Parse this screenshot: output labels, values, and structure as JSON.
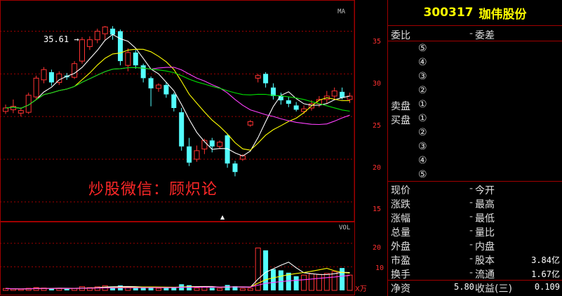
{
  "stock": {
    "code": "300317",
    "name": "珈伟股份"
  },
  "chart": {
    "ma_tag": "MA",
    "vol_tag": "VOL",
    "vol_unit": "X万",
    "high_label": "35.61",
    "watermark": "炒股微信：顾炽论",
    "price_ticks": [
      "35",
      "30",
      "25",
      "20",
      "15"
    ],
    "vol_ticks": [
      "20",
      "10"
    ]
  },
  "panel": {
    "weibi_label": "委比",
    "weicha_label": "委差",
    "sell_label": "卖盘",
    "buy_label": "买盘",
    "sell_levels": [
      "⑤",
      "④",
      "③",
      "②",
      "①"
    ],
    "buy_levels": [
      "①",
      "②",
      "③",
      "④",
      "⑤"
    ],
    "quote_rows": [
      {
        "l": "现价",
        "r": "今开",
        "v": ""
      },
      {
        "l": "涨跌",
        "r": "最高",
        "v": ""
      },
      {
        "l": "涨幅",
        "r": "最低",
        "v": ""
      },
      {
        "l": "总量",
        "r": "量比",
        "v": ""
      },
      {
        "l": "外盘",
        "r": "内盘",
        "v": ""
      },
      {
        "l": "市盈",
        "r": "股本",
        "v": "3.84亿"
      },
      {
        "l": "换手",
        "r": "流通",
        "v": "1.67亿"
      }
    ],
    "jingzi_label": "净资",
    "jingzi_value": "5.80",
    "shouyi_label": "收益(三)",
    "shouyi_value": "0.109"
  },
  "chart_data": {
    "type": "candlestick",
    "y_range": [
      14,
      38
    ],
    "candles": [
      [
        25.6,
        26.0,
        25.3,
        26.4
      ],
      [
        25.8,
        26.2,
        25.4,
        27.0
      ],
      [
        25.4,
        25.7,
        25.0,
        26.0
      ],
      [
        25.5,
        27.5,
        25.3,
        27.8
      ],
      [
        27.3,
        29.5,
        27.0,
        29.8
      ],
      [
        29.3,
        30.5,
        28.9,
        30.8
      ],
      [
        30.2,
        29.0,
        28.6,
        30.5
      ],
      [
        29.0,
        30.0,
        28.7,
        30.3
      ],
      [
        29.8,
        29.6,
        29.3,
        30.1
      ],
      [
        29.6,
        31.2,
        29.4,
        31.5
      ],
      [
        31.5,
        34.0,
        31.2,
        34.3
      ],
      [
        33.2,
        34.0,
        32.8,
        34.4
      ],
      [
        34.0,
        35.0,
        33.6,
        35.3
      ],
      [
        34.7,
        35.5,
        34.0,
        35.61
      ],
      [
        35.3,
        34.6,
        34.0,
        35.6
      ],
      [
        35.0,
        31.5,
        31.0,
        35.2
      ],
      [
        31.0,
        32.5,
        30.3,
        33.0
      ],
      [
        32.5,
        31.0,
        30.6,
        32.8
      ],
      [
        31.0,
        29.5,
        29.0,
        31.2
      ],
      [
        29.5,
        28.3,
        26.2,
        29.7
      ],
      [
        28.3,
        28.7,
        27.9,
        28.9
      ],
      [
        28.7,
        27.6,
        27.2,
        29.0
      ],
      [
        27.6,
        26.0,
        25.6,
        27.8
      ],
      [
        25.5,
        21.5,
        21.0,
        26.0
      ],
      [
        21.5,
        19.6,
        19.2,
        22.5
      ],
      [
        20.0,
        21.0,
        19.7,
        21.6
      ],
      [
        21.2,
        22.2,
        20.6,
        22.4
      ],
      [
        22.2,
        21.5,
        20.8,
        22.5
      ],
      [
        21.5,
        22.0,
        21.3,
        22.2
      ],
      [
        22.8,
        19.5,
        19.0,
        23.0
      ],
      [
        19.5,
        18.5,
        18.0,
        19.8
      ],
      [
        20.0,
        20.4,
        19.8,
        20.6
      ],
      [
        24.0,
        24.4,
        23.8,
        24.6
      ],
      [
        29.5,
        29.8,
        29.0,
        30.0
      ],
      [
        30.0,
        28.9,
        28.4,
        30.2
      ],
      [
        28.4,
        27.4,
        27.0,
        28.9
      ],
      [
        27.4,
        26.9,
        26.4,
        27.8
      ],
      [
        26.9,
        26.5,
        26.1,
        27.3
      ],
      [
        26.3,
        25.8,
        25.6,
        26.7
      ],
      [
        25.6,
        25.9,
        25.3,
        26.3
      ],
      [
        26.0,
        26.5,
        25.7,
        26.9
      ],
      [
        26.5,
        27.0,
        26.1,
        27.4
      ],
      [
        27.0,
        27.4,
        26.5,
        28.0
      ],
      [
        27.4,
        28.0,
        27.0,
        28.4
      ],
      [
        27.9,
        27.2,
        27.0,
        28.4
      ],
      [
        27.0,
        27.4,
        26.6,
        27.8
      ]
    ],
    "volumes": [
      0.8,
      0.6,
      0.5,
      0.9,
      1.2,
      1.0,
      0.9,
      0.8,
      0.7,
      0.9,
      1.6,
      1.2,
      1.5,
      2.0,
      1.4,
      2.1,
      1.3,
      1.1,
      1.2,
      1.5,
      0.9,
      1.0,
      1.2,
      2.6,
      2.2,
      1.0,
      1.4,
      1.1,
      0.9,
      2.3,
      1.8,
      0.8,
      0.9,
      18.0,
      17.0,
      9.0,
      8.5,
      7.5,
      6.0,
      6.5,
      7.0,
      6.8,
      7.2,
      8.0,
      9.5,
      6.5
    ],
    "vol_range": [
      0,
      28
    ]
  }
}
